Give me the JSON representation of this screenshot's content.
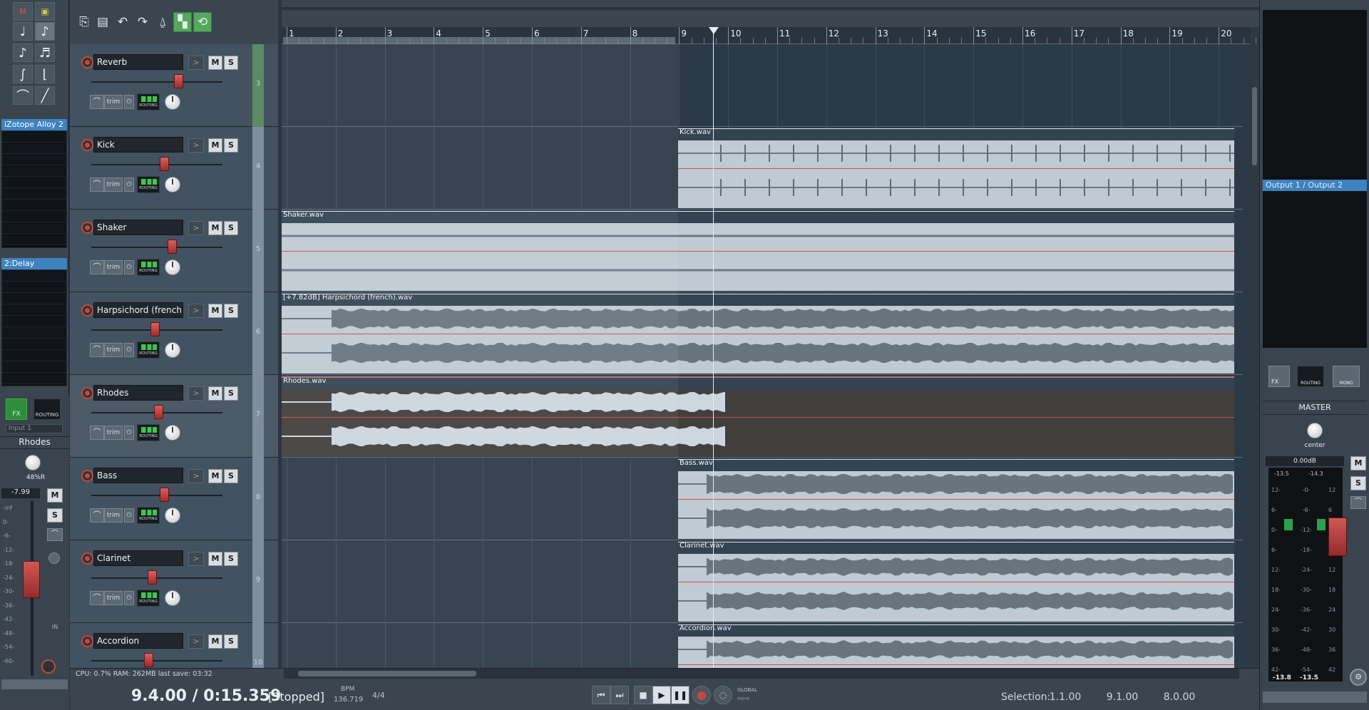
{
  "leftstrip": {
    "fx_title": "iZotope Alloy 2",
    "send_title": "2:Delay",
    "input_label": "Input 1",
    "track_name": "Rhodes",
    "pan_value": "48%R",
    "volume_db": "-7.99",
    "fx_label": "FX",
    "routing_label": "ROUTING",
    "m_label": "M",
    "s_label": "S",
    "in_label": "IN",
    "scale": [
      "-inf",
      "0-",
      "-6-",
      "-12-",
      "-18-",
      "-24-",
      "-30-",
      "-36-",
      "-42-",
      "-48-",
      "-54-",
      "-60-"
    ]
  },
  "toolbar": {
    "icons": [
      "project-actions-icon",
      "save-icon",
      "undo-icon",
      "redo-icon",
      "metronome-icon",
      "grid-snap-icon",
      "loop-icon"
    ]
  },
  "tracks": [
    {
      "name": "Reverb",
      "num": "3",
      "fader": 0.63
    },
    {
      "name": "Kick",
      "num": "4",
      "fader": 0.52
    },
    {
      "name": "Shaker",
      "num": "5",
      "fader": 0.58
    },
    {
      "name": "Harpsichord (french)",
      "num": "6",
      "fader": 0.45
    },
    {
      "name": "Rhodes",
      "num": "7",
      "fader": 0.48
    },
    {
      "name": "Bass",
      "num": "8",
      "fader": 0.52
    },
    {
      "name": "Clarinet",
      "num": "9",
      "fader": 0.43
    },
    {
      "name": "Accordion",
      "num": "10",
      "fader": 0.4
    }
  ],
  "track_controls": {
    "m": "M",
    "s": "S",
    "trim": "trim",
    "routing": "ROUTING",
    "arrow": ">"
  },
  "ruler": [
    "1",
    "2",
    "3",
    "4",
    "5",
    "6",
    "7",
    "8",
    "9",
    "10",
    "11",
    "12",
    "13",
    "14",
    "15",
    "16",
    "17",
    "18",
    "19",
    "20"
  ],
  "items": [
    {
      "track": 1,
      "label": "Kick.wav"
    },
    {
      "track": 2,
      "label": "Shaker.wav"
    },
    {
      "track": 3,
      "label": "[+7.82dB] Harpsichord (french).wav"
    },
    {
      "track": 4,
      "label": "Rhodes.wav"
    },
    {
      "track": 5,
      "label": "Bass.wav"
    },
    {
      "track": 6,
      "label": "Clarinet.wav"
    },
    {
      "track": 7,
      "label": "Accordion.wav"
    }
  ],
  "transport": {
    "status": "CPU: 0.7% RAM: 262MB last save: 03:32",
    "position": "9.4.00 / 0:15.359",
    "state": "[Stopped]",
    "bpm_label": "BPM",
    "bpm": "136.719",
    "signature": "4/4",
    "global_label": "GLOBAL",
    "global_value": "none",
    "selection_label": "Selection:",
    "selection_start": "1.1.00",
    "selection_end": "9.1.00",
    "selection_length": "8.0.00"
  },
  "master": {
    "output": "Output 1 / Output 2",
    "title": "MASTER",
    "pan": "center",
    "gain": "0.00dB",
    "peak_l": "-13.5",
    "peak_r": "-14.3",
    "meter_l": "-13.8",
    "meter_r": "-13.5",
    "fx_label": "FX",
    "routing_label": "ROUTING",
    "mono_label": "MONO",
    "m_label": "M",
    "s_label": "S",
    "scale_left": [
      "12-",
      "6-",
      "0-",
      "6-",
      "12-",
      "18-",
      "24-",
      "30-",
      "36-",
      "42-"
    ],
    "scale_mid": [
      "-0-",
      "-6-",
      "-12-",
      "-18-",
      "-24-",
      "-30-",
      "-36-",
      "-42-",
      "-48-",
      "-54-"
    ],
    "scale_right": [
      "12",
      "6",
      "0",
      "6",
      "12",
      "18",
      "24",
      "30",
      "36",
      "42"
    ]
  },
  "colors": {
    "accent": "#3ec84a",
    "rec": "#c24a3a",
    "fader": "#b33b3b",
    "item": "#bfcad4",
    "waveform": "#6a7782"
  }
}
